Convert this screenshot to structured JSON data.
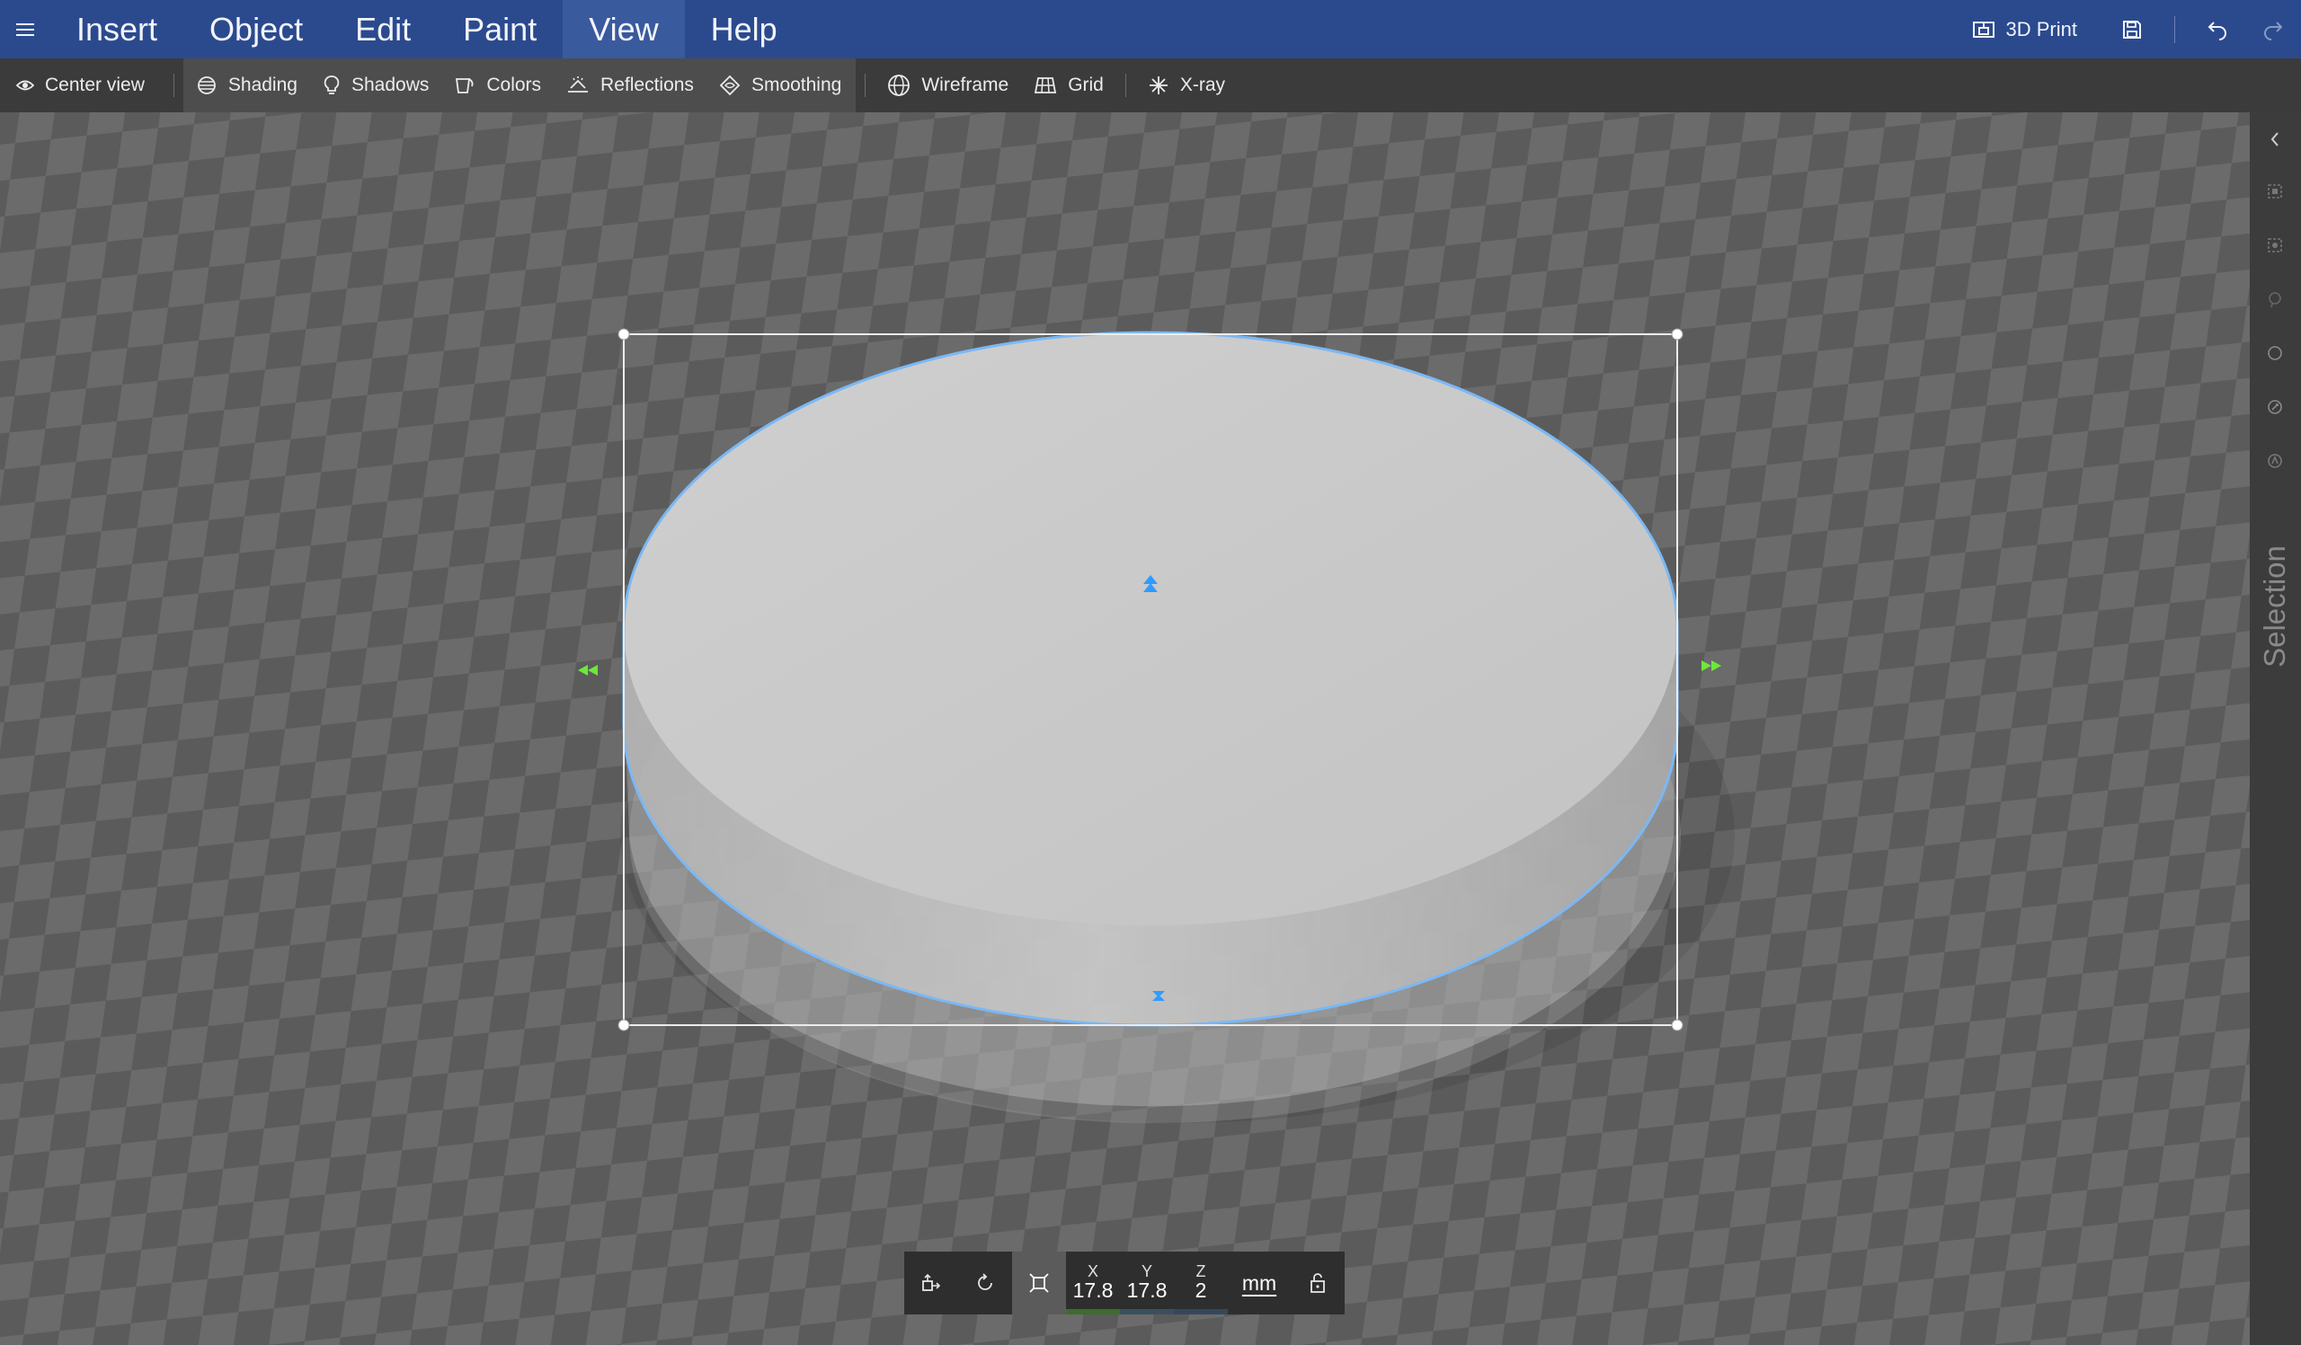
{
  "menubar": {
    "items": [
      {
        "label": "Insert"
      },
      {
        "label": "Object"
      },
      {
        "label": "Edit"
      },
      {
        "label": "Paint"
      },
      {
        "label": "View",
        "active": true
      },
      {
        "label": "Help"
      }
    ],
    "print_label": "3D Print"
  },
  "toolbar": {
    "center_view": "Center view",
    "shading": "Shading",
    "shadows": "Shadows",
    "colors": "Colors",
    "reflections": "Reflections",
    "smoothing": "Smoothing",
    "wireframe": "Wireframe",
    "grid": "Grid",
    "xray": "X-ray"
  },
  "side_panel": {
    "label": "Selection"
  },
  "transform": {
    "x_label": "X",
    "x_value": "17.8",
    "y_label": "Y",
    "y_value": "17.8",
    "z_label": "Z",
    "z_value": "2",
    "unit": "mm"
  },
  "colors": {
    "menubar_bg": "#2b4a8e",
    "toolbar_bg": "#3b3b3b",
    "selection_outline": "#7ab8f5",
    "handle_blue": "#2f9bff",
    "handle_green": "#6ee83a"
  }
}
